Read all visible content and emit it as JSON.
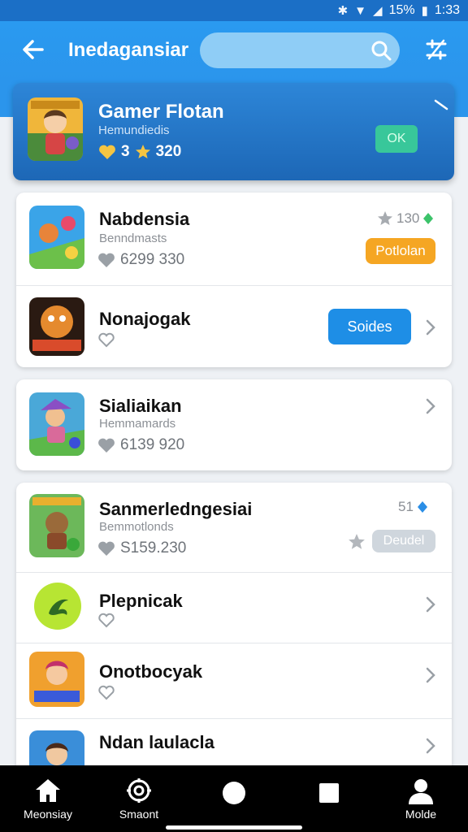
{
  "status_bar": {
    "battery": "15%",
    "time": "1:33",
    "icons": [
      "bluetooth-icon",
      "wifi-icon",
      "signal-icon",
      "battery-icon"
    ]
  },
  "app_bar": {
    "title": "Inedagansiar",
    "search_placeholder": ""
  },
  "featured": {
    "title": "Gamer Flotan",
    "subtitle": "Hemundiedis",
    "hearts": "3",
    "stars": "320",
    "button": "OK"
  },
  "list_group_1": [
    {
      "title": "Nabdensia",
      "subtitle": "Benndmasts",
      "stats": "6299 330",
      "rating": "130",
      "pill": "Potlolan",
      "pill_color": "#f5a623"
    },
    {
      "title": "Nonajogak",
      "button": "Soides",
      "button_color": "#1e8ee6"
    }
  ],
  "list_group_2": [
    {
      "title": "Sialiaikan",
      "subtitle": "Hemmamards",
      "stats": "6139 920"
    }
  ],
  "list_group_3": [
    {
      "title": "Sanmerledngesiai",
      "subtitle": "Bemmotlonds",
      "stats": "S159.230",
      "rating": "51",
      "pill": "Deudel",
      "pill_color": "#cfd6dd"
    },
    {
      "title": "Plepnicak"
    },
    {
      "title": "Onotbocyak"
    },
    {
      "title": "Ndan laulacla"
    }
  ],
  "bottom_nav": [
    {
      "label": "Meonsiay",
      "icon": "home-icon"
    },
    {
      "label": "Smaont",
      "icon": "gear-icon"
    },
    {
      "label": "",
      "icon": "circle-icon"
    },
    {
      "label": "",
      "icon": "square-icon"
    },
    {
      "label": "Molde",
      "icon": "profile-icon"
    }
  ],
  "colors": {
    "primary": "#2b95ec",
    "featured_dark": "#1d67b6",
    "accent_green": "#38c79a",
    "accent_orange": "#f5a623"
  }
}
